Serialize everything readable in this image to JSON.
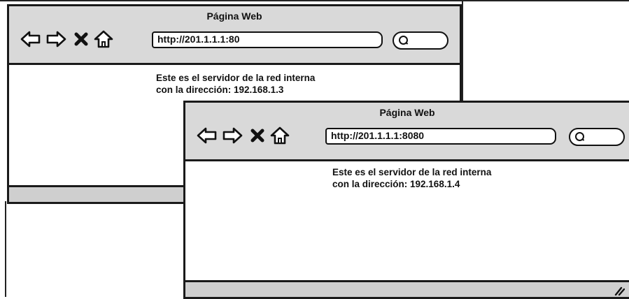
{
  "windows": [
    {
      "title": "Página Web",
      "url": "http://201.1.1.1:80",
      "content_line1": "Este es el servidor de la red interna",
      "content_line2": "con la dirección: 192.168.1.3"
    },
    {
      "title": "Página Web",
      "url": "http://201.1.1.1:8080",
      "content_line1": "Este es el servidor de la red interna",
      "content_line2": "con la dirección: 192.168.1.4"
    }
  ],
  "icons": {
    "back": "back-arrow-icon",
    "forward": "forward-arrow-icon",
    "stop": "close-icon",
    "home": "home-icon",
    "search": "search-icon",
    "resize": "resize-grip-icon"
  },
  "colors": {
    "titlebar": "#d9d9d9",
    "statusbar": "#cfcfcf",
    "stroke": "#1a1a1a"
  }
}
